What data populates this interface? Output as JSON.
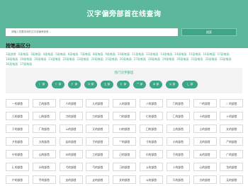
{
  "header": {
    "title": "汉字偏旁部首在线查询",
    "search_placeholder": "请输入您要查询的汉字或偏旁部首...",
    "search_button": "搜索"
  },
  "strokes": {
    "title": "按笔画区分",
    "items": [
      "1画部首",
      "2画笔画",
      "3画笔画",
      "4画笔画",
      "5画笔画",
      "6画笔画",
      "7画笔画",
      "8画笔画",
      "9画笔画",
      "10画笔画",
      "11画笔画",
      "12画笔画",
      "13画笔画",
      "14画笔画",
      "15画笔画",
      "16画笔画",
      "17画笔画",
      "18画笔画",
      "19画笔画",
      "20画笔画",
      "21画笔画",
      "22画笔画",
      "23画笔画",
      "24画笔画",
      "25画笔画",
      "26画笔画",
      "27画笔画",
      "28画笔画",
      "29画笔画",
      "30画笔画",
      "31画笔画",
      "32画笔画",
      "33画笔画",
      "36画笔画",
      "37画笔画"
    ]
  },
  "hot": {
    "title": "热门汉字部首",
    "tags": [
      "氵 部",
      "亻 部",
      "扌 部",
      "口 部",
      "土 部",
      "钅 部",
      "艹 部",
      "木 部",
      "火 部",
      "辶 部",
      "石 部",
      "王 部",
      "日 部",
      "虫 部"
    ]
  },
  "radicals": [
    "一的部首",
    "乙的部首",
    "人的部首",
    "儿的部首",
    "入的部首",
    "八的部首",
    "冂的部首",
    "冖的部首",
    "冫的部首",
    "几的部首",
    "凵的部首",
    "刀的部首",
    "力的部首",
    "勹的部首",
    "匕的部首",
    "匚的部首",
    "十的部首",
    "卜的部首",
    "卩的部首",
    "厂的部首",
    "厶的部首",
    "又的部首",
    "口的部首",
    "囗的部首",
    "土的部首",
    "士的部首",
    "夂的部首",
    "夕的部首",
    "大的部首",
    "女的部首",
    "子的部首",
    "宀的部首",
    "寸的部首",
    "小的部首",
    "尢的部首",
    "尸的部首",
    "屮的部首",
    "山的部首",
    "巛的部首",
    "工的部首",
    "己的部首",
    "巾的部首",
    "干的部首",
    "幺的部首",
    "广的部首",
    "廴的部首",
    "廾的部首",
    "弋的部首",
    "弓的部首",
    "彐的部首",
    "彡的部首",
    "彳的部首",
    "心的部首",
    "戈的部首",
    "户的部首",
    "手的部首",
    "支的部首",
    "攴的部首",
    "文的部首",
    "斗的部首",
    "斤的部首",
    "方的部首",
    "无的部首"
  ]
}
